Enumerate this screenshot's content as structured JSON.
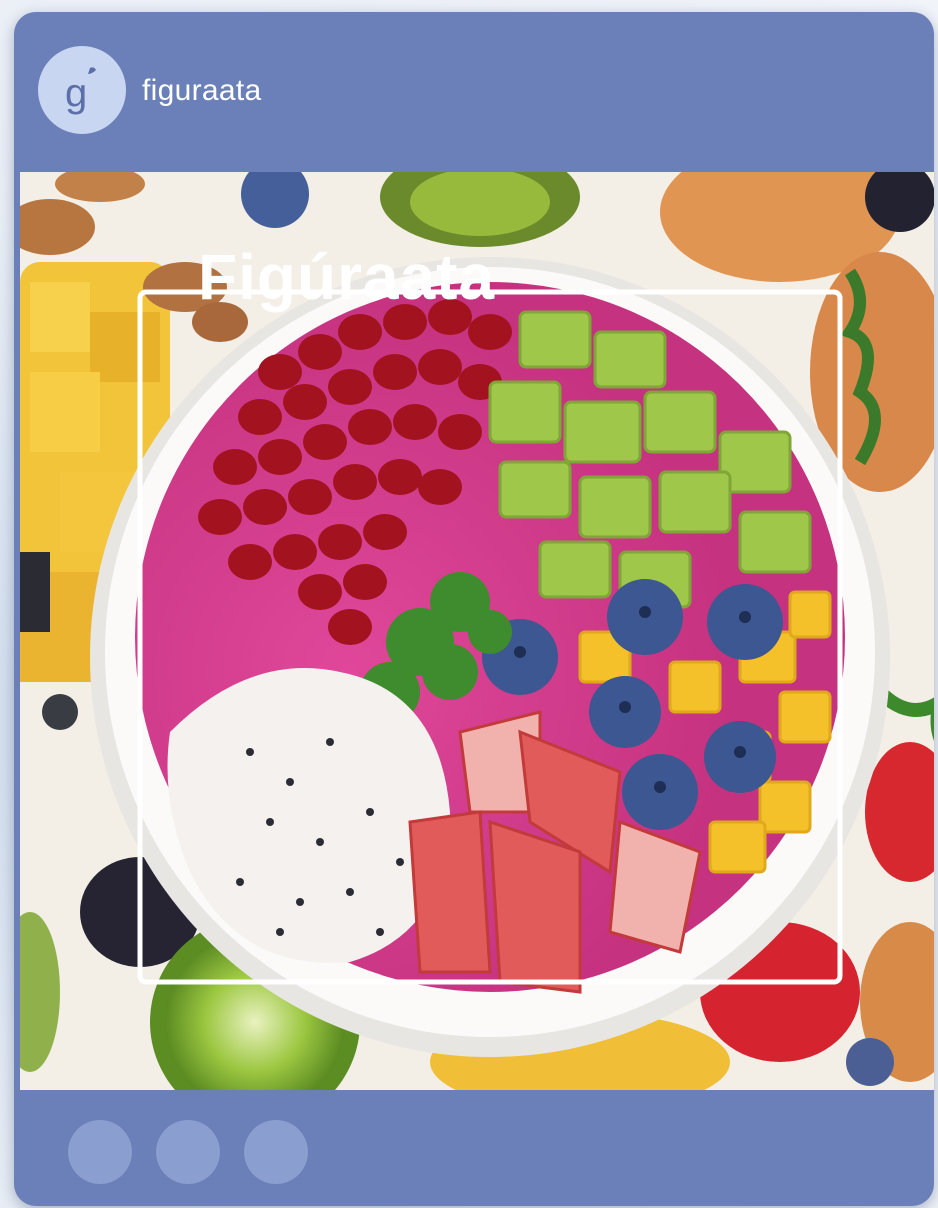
{
  "post": {
    "account_name": "figuraata",
    "avatar_letter": "g",
    "brand_overlay": "Figúraata",
    "image_subject": "fruit-bowl-photo"
  },
  "carousel": {
    "dots": [
      "dot-1",
      "dot-2",
      "dot-3"
    ]
  },
  "colors": {
    "card": "#6b80b8",
    "avatar_bg": "#c9d6f2",
    "dot": "#8b9ed0"
  }
}
